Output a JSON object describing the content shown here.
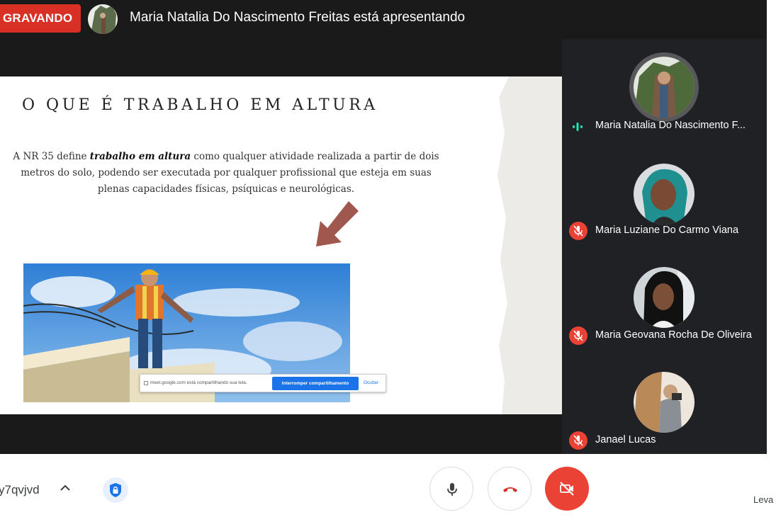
{
  "recording": {
    "label": "GRAVANDO"
  },
  "presenter": {
    "text": "Maria Natalia Do Nascimento Freitas está apresentando"
  },
  "slide": {
    "title": "O QUE É TRABALHO EM ALTURA",
    "body_prefix": "A NR 35 define ",
    "body_emphasis": "trabalho em altura",
    "body_suffix": " como qualquer atividade realizada a partir de dois metros do solo, podendo ser executada por qualquer profissional que esteja em suas plenas capacidades físicas, psíquicas e neurológicas.",
    "share_banner": {
      "text": "meet.google.com está compartilhando sua tela.",
      "stop_button": "Interromper compartilhamento",
      "hide_link": "Ocultar"
    }
  },
  "participants": [
    {
      "name": "Maria Natalia Do Nascimento F...",
      "status": "speaking"
    },
    {
      "name": "Maria Luziane Do Carmo Viana",
      "status": "muted"
    },
    {
      "name": "Maria Geovana Rocha De Oliveira",
      "status": "muted"
    },
    {
      "name": "Janael Lucas",
      "status": "muted"
    }
  ],
  "controls": {
    "meeting_code": "y7qvjvd",
    "leave_label": "Leva"
  },
  "colors": {
    "record_red": "#d93025",
    "muted_red": "#ea4335",
    "dark_bg": "#1a1a1a",
    "panel_bg": "#202124",
    "speaking_teal": "#1de9b6",
    "accent_blue": "#1a73e8"
  }
}
